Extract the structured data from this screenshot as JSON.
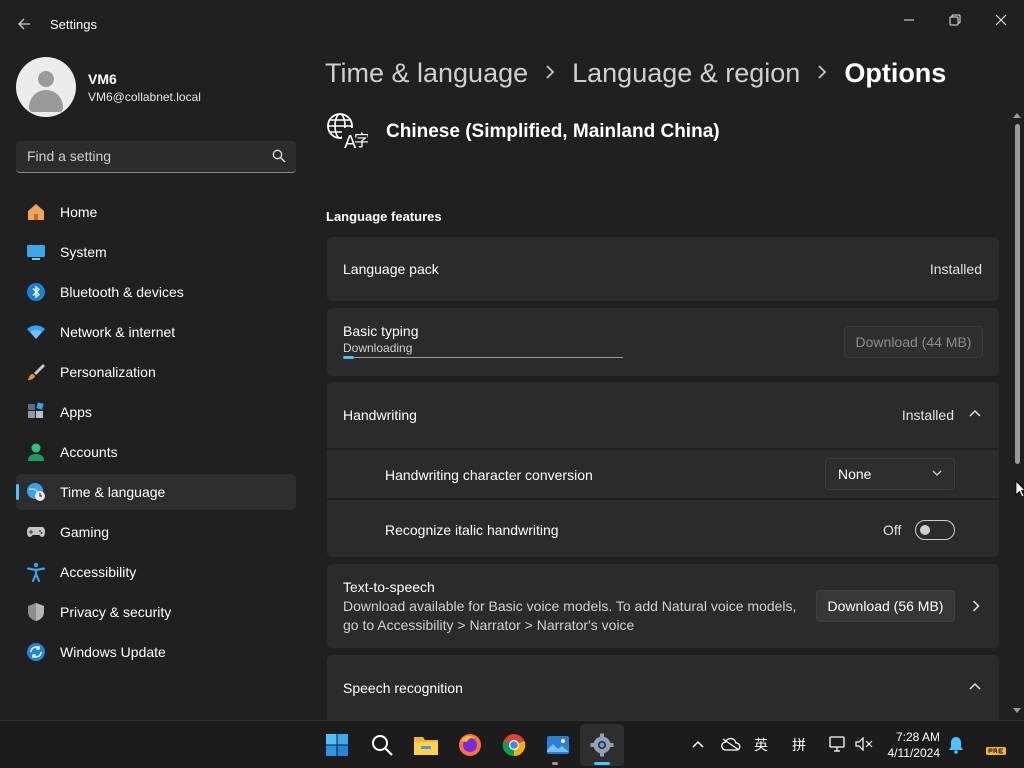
{
  "window": {
    "title": "Settings",
    "controls": [
      "minimize",
      "maximize",
      "close"
    ]
  },
  "profile": {
    "name": "VM6",
    "email": "VM6@collabnet.local"
  },
  "search": {
    "placeholder": "Find a setting"
  },
  "sidebar": {
    "items": [
      {
        "label": "Home",
        "icon": "home-icon"
      },
      {
        "label": "System",
        "icon": "system-icon"
      },
      {
        "label": "Bluetooth & devices",
        "icon": "bluetooth-icon"
      },
      {
        "label": "Network & internet",
        "icon": "wifi-icon"
      },
      {
        "label": "Personalization",
        "icon": "brush-icon"
      },
      {
        "label": "Apps",
        "icon": "apps-icon"
      },
      {
        "label": "Accounts",
        "icon": "accounts-icon"
      },
      {
        "label": "Time & language",
        "icon": "time-language-icon",
        "active": true
      },
      {
        "label": "Gaming",
        "icon": "gamepad-icon"
      },
      {
        "label": "Accessibility",
        "icon": "accessibility-icon"
      },
      {
        "label": "Privacy & security",
        "icon": "shield-icon"
      },
      {
        "label": "Windows Update",
        "icon": "update-icon"
      }
    ]
  },
  "breadcrumb": {
    "items": [
      "Time & language",
      "Language & region"
    ],
    "current": "Options"
  },
  "language": {
    "title": "Chinese (Simplified, Mainland China)",
    "icon": "language-icon"
  },
  "features": {
    "section_title": "Language features",
    "language_pack": {
      "label": "Language pack",
      "status": "Installed"
    },
    "basic_typing": {
      "label": "Basic typing",
      "sub": "Downloading",
      "progress": 0.04,
      "button": "Download (44 MB)"
    },
    "handwriting": {
      "label": "Handwriting",
      "status": "Installed"
    },
    "hw_conversion": {
      "label": "Handwriting character conversion",
      "value": "None"
    },
    "italic": {
      "label": "Recognize italic handwriting",
      "state": "Off"
    },
    "tts": {
      "label": "Text-to-speech",
      "desc1": "Download available for Basic voice models. To add Natural voice models,",
      "desc2": "go to Accessibility > Narrator > Narrator's voice",
      "button": "Download (56 MB)"
    },
    "speech": {
      "label": "Speech recognition"
    }
  },
  "taskbar": {
    "apps": [
      "start-icon",
      "search-icon",
      "file-explorer-icon",
      "firefox-icon",
      "chrome-icon",
      "photos-icon",
      "settings-icon"
    ],
    "tray": {
      "ime_mode": "英",
      "ime_name": "拼"
    },
    "time": "7:28 AM",
    "date": "4/11/2024"
  },
  "colors": {
    "accent": "#4cc2ff",
    "background": "#202020",
    "card": "#2b2b2b",
    "taskbar": "#1c1c1c"
  }
}
